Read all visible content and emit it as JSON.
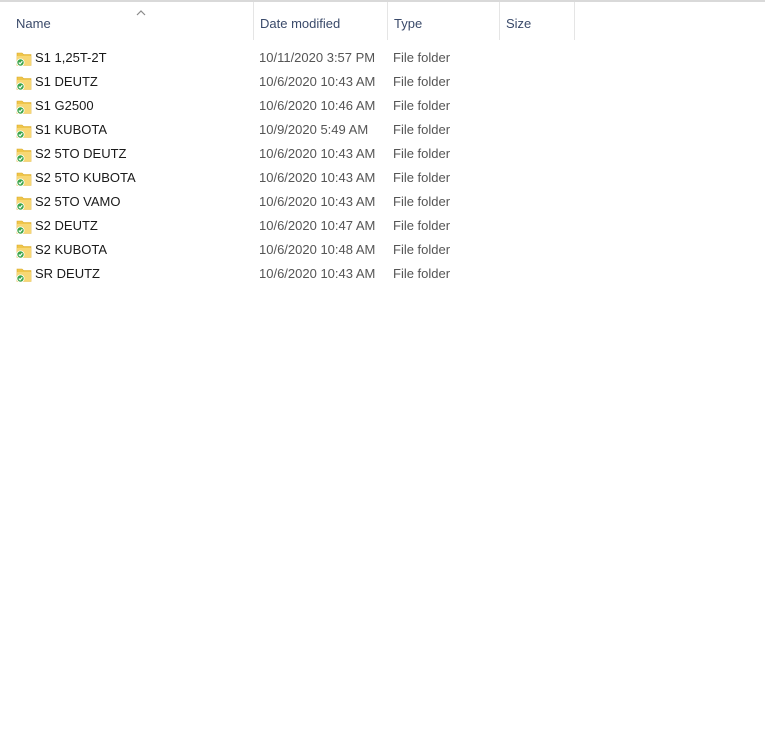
{
  "columns": {
    "name": "Name",
    "date": "Date modified",
    "type": "Type",
    "size": "Size"
  },
  "sort_indicator": "ascending",
  "accent_colors": {
    "folder": "#f0c64a",
    "sync_check": "#3aa54a"
  },
  "rows": [
    {
      "name": "S1 1,25T-2T",
      "date": "10/11/2020 3:57 PM",
      "type": "File folder",
      "size": "",
      "icon": "folder-synced-icon"
    },
    {
      "name": "S1 DEUTZ",
      "date": "10/6/2020 10:43 AM",
      "type": "File folder",
      "size": "",
      "icon": "folder-synced-icon"
    },
    {
      "name": "S1 G2500",
      "date": "10/6/2020 10:46 AM",
      "type": "File folder",
      "size": "",
      "icon": "folder-synced-icon"
    },
    {
      "name": "S1 KUBOTA",
      "date": "10/9/2020 5:49 AM",
      "type": "File folder",
      "size": "",
      "icon": "folder-synced-icon"
    },
    {
      "name": "S2 5TO DEUTZ",
      "date": "10/6/2020 10:43 AM",
      "type": "File folder",
      "size": "",
      "icon": "folder-synced-icon"
    },
    {
      "name": "S2 5TO KUBOTA",
      "date": "10/6/2020 10:43 AM",
      "type": "File folder",
      "size": "",
      "icon": "folder-synced-icon"
    },
    {
      "name": "S2 5TO VAMO",
      "date": "10/6/2020 10:43 AM",
      "type": "File folder",
      "size": "",
      "icon": "folder-synced-icon"
    },
    {
      "name": "S2 DEUTZ",
      "date": "10/6/2020 10:47 AM",
      "type": "File folder",
      "size": "",
      "icon": "folder-synced-icon"
    },
    {
      "name": "S2 KUBOTA",
      "date": "10/6/2020 10:48 AM",
      "type": "File folder",
      "size": "",
      "icon": "folder-synced-icon"
    },
    {
      "name": "SR DEUTZ",
      "date": "10/6/2020 10:43 AM",
      "type": "File folder",
      "size": "",
      "icon": "folder-synced-icon"
    }
  ]
}
